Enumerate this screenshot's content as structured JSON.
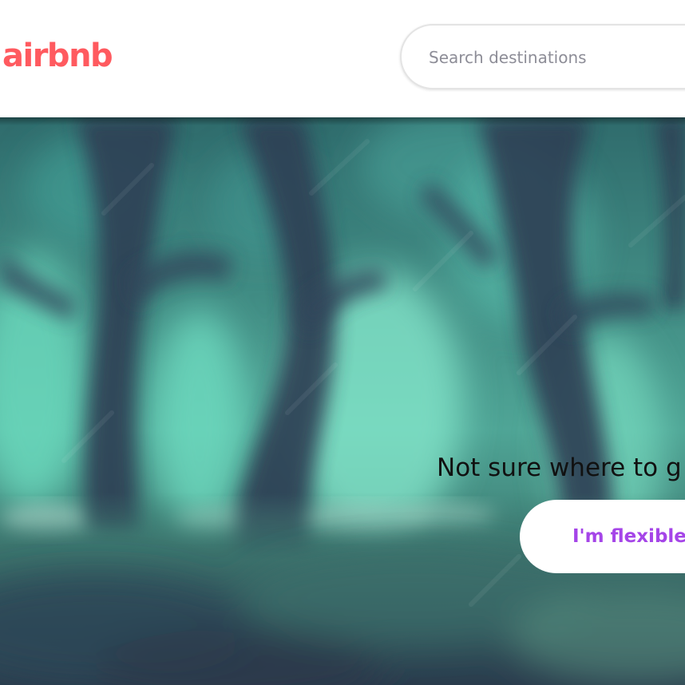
{
  "header": {
    "logo_text": "airbnb",
    "search": {
      "placeholder": "Search destinations",
      "value": ""
    }
  },
  "hero": {
    "heading": "Not sure where to g",
    "cta_label": "I'm flexible"
  },
  "colors": {
    "brand": "#ff5a5f",
    "cta_text": "#a545e8",
    "hero_tint": "#3b6a6a"
  }
}
